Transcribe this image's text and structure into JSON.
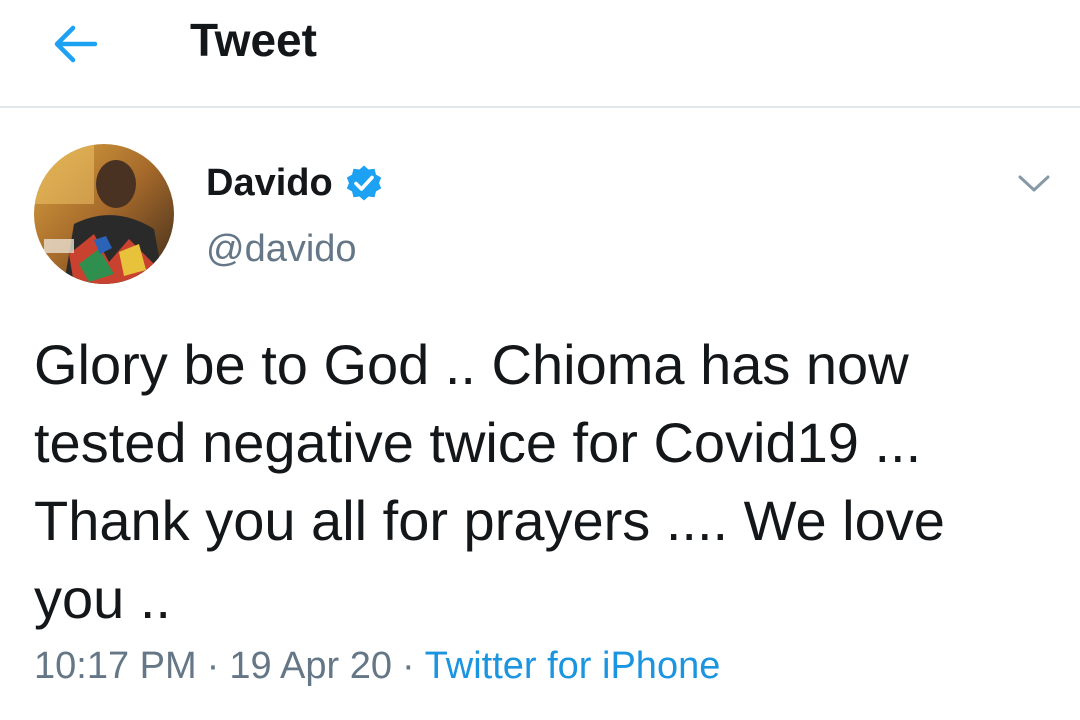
{
  "header": {
    "title": "Tweet",
    "back_icon": "arrow-left-icon"
  },
  "tweet": {
    "author": {
      "name": "Davido",
      "handle": "@davido",
      "verified": true
    },
    "text": "Glory be to God .. Chioma has now tested negative twice for Covid19 ... Thank you all for prayers .... We love you ..",
    "time": "10:17 PM",
    "date": "19 Apr 20",
    "separator": "·",
    "source": "Twitter for iPhone"
  },
  "colors": {
    "accent": "#1da1f2",
    "link": "#1b95e0",
    "text_primary": "#14171a",
    "text_secondary": "#657786",
    "divider": "#e1e8ed"
  }
}
